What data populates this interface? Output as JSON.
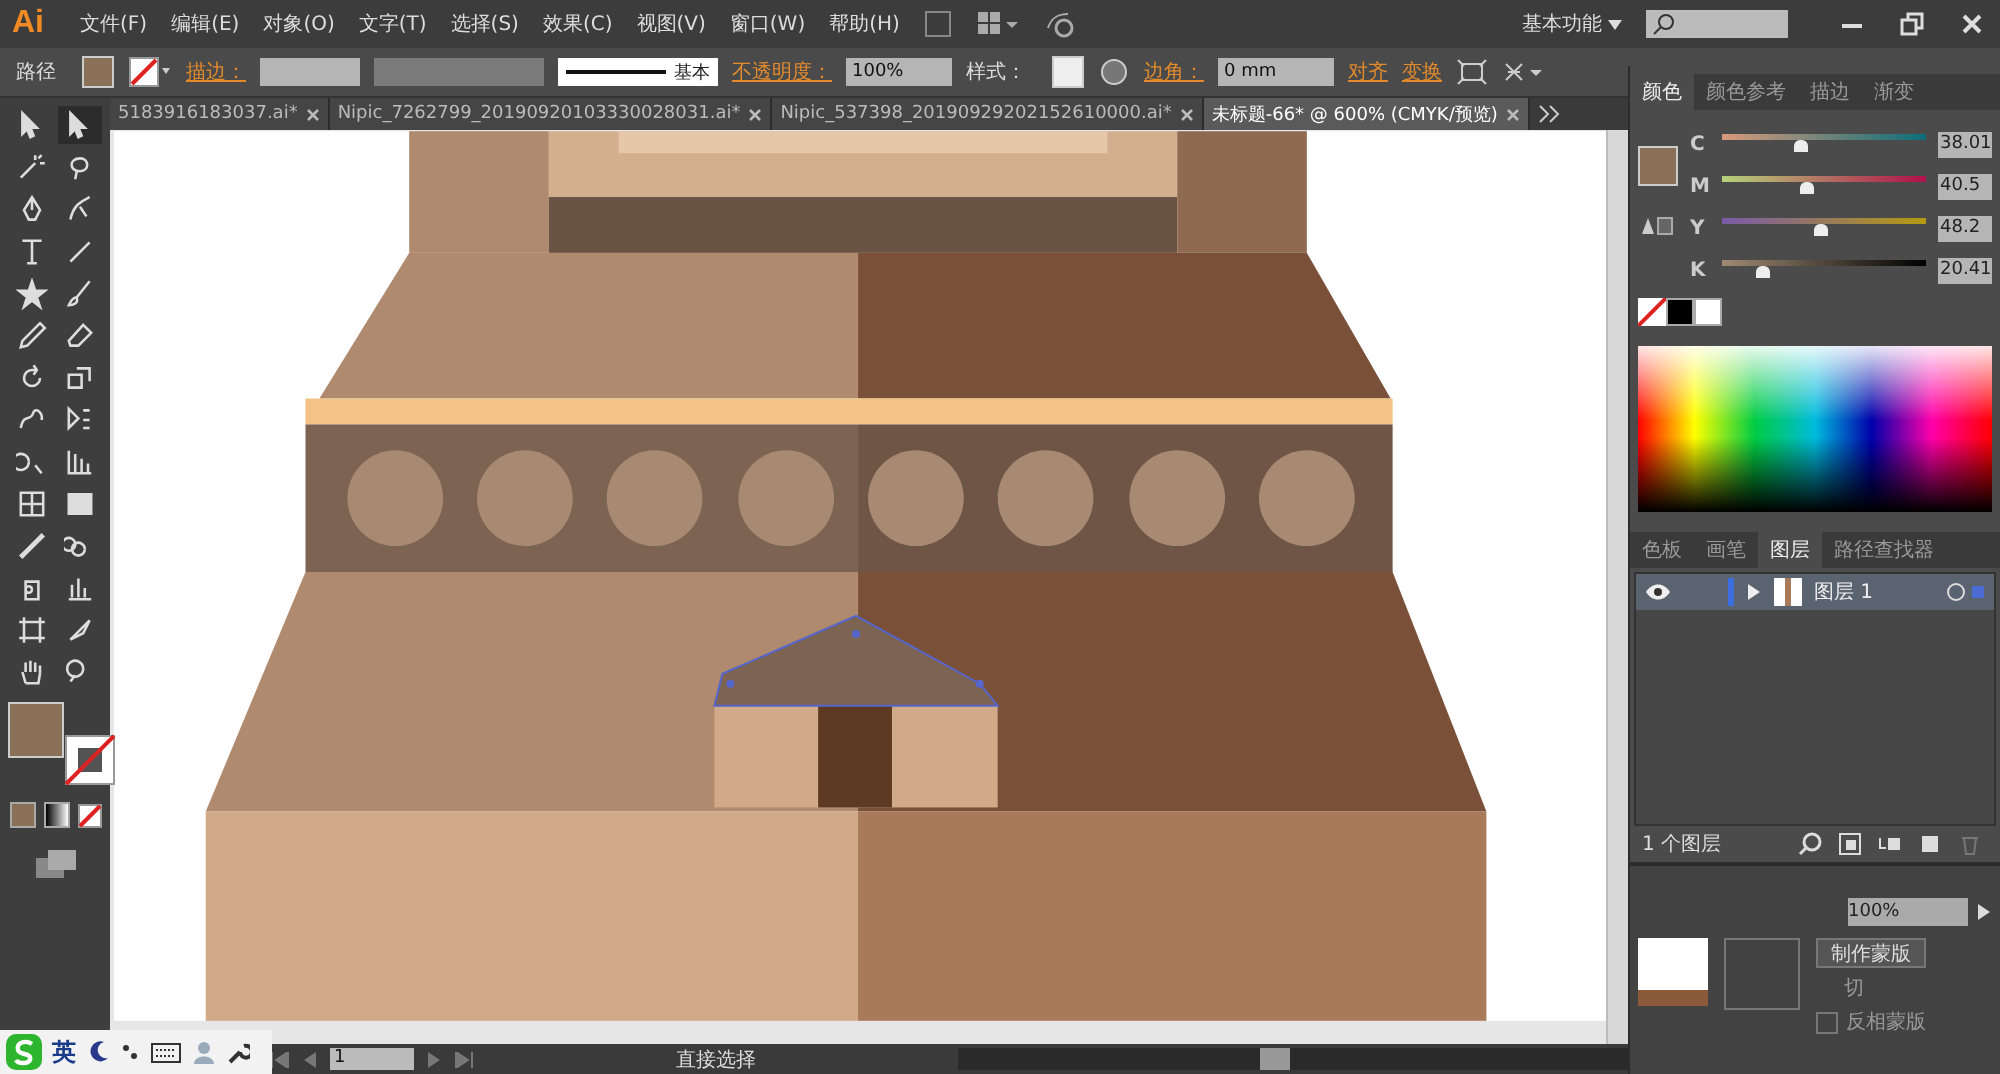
{
  "app": {
    "logo": "Ai",
    "menu": [
      "文件(F)",
      "编辑(E)",
      "对象(O)",
      "文字(T)",
      "选择(S)",
      "效果(C)",
      "视图(V)",
      "窗口(W)",
      "帮助(H)"
    ],
    "workspace": "基本功能"
  },
  "control_bar": {
    "object_type": "路径",
    "stroke_label": "描边：",
    "stroke_style": "基本",
    "opacity_label": "不透明度：",
    "opacity": "100%",
    "style_label": "样式：",
    "corner_label": "边角：",
    "corner": "0 mm",
    "align": "对齐",
    "transform": "变换"
  },
  "doc_tabs": [
    {
      "label": "5183916183037.ai*",
      "selected": false
    },
    {
      "label": "Nipic_7262799_20190920103330028031.ai*",
      "selected": false
    },
    {
      "label": "Nipic_537398_20190929202152610000.ai*",
      "selected": false
    },
    {
      "label": "未标题-66* @ 600% (CMYK/预览)",
      "selected": true
    }
  ],
  "color_panel": {
    "tabs": [
      {
        "label": "颜色",
        "selected": true
      },
      {
        "label": "颜色参考",
        "selected": false
      },
      {
        "label": "描边",
        "selected": false
      },
      {
        "label": "渐变",
        "selected": false
      }
    ],
    "sliders": [
      {
        "name": "C",
        "level": 0.38,
        "reading": "38.01"
      },
      {
        "name": "M",
        "level": 0.41,
        "reading": "40.5"
      },
      {
        "name": "Y",
        "level": 0.48,
        "reading": "48.2"
      },
      {
        "name": "K",
        "level": 0.2,
        "reading": "20.41"
      }
    ]
  },
  "layers_panel": {
    "tabs": [
      {
        "label": "色板",
        "selected": false
      },
      {
        "label": "画笔",
        "selected": false
      },
      {
        "label": "图层",
        "selected": true
      },
      {
        "label": "路径查找器",
        "selected": false
      }
    ],
    "layers": [
      {
        "name": "图层 1",
        "visible": true
      }
    ],
    "count": "1 个图层"
  },
  "transparency_panel": {
    "opacity": "100%",
    "make_mask": "制作蒙版",
    "clip": "切",
    "invert_mask": "反相蒙版",
    "invert_checked": false
  },
  "status_bar": {
    "page": "1",
    "tool": "直接选择"
  },
  "ime_bar": {
    "language": "英"
  }
}
